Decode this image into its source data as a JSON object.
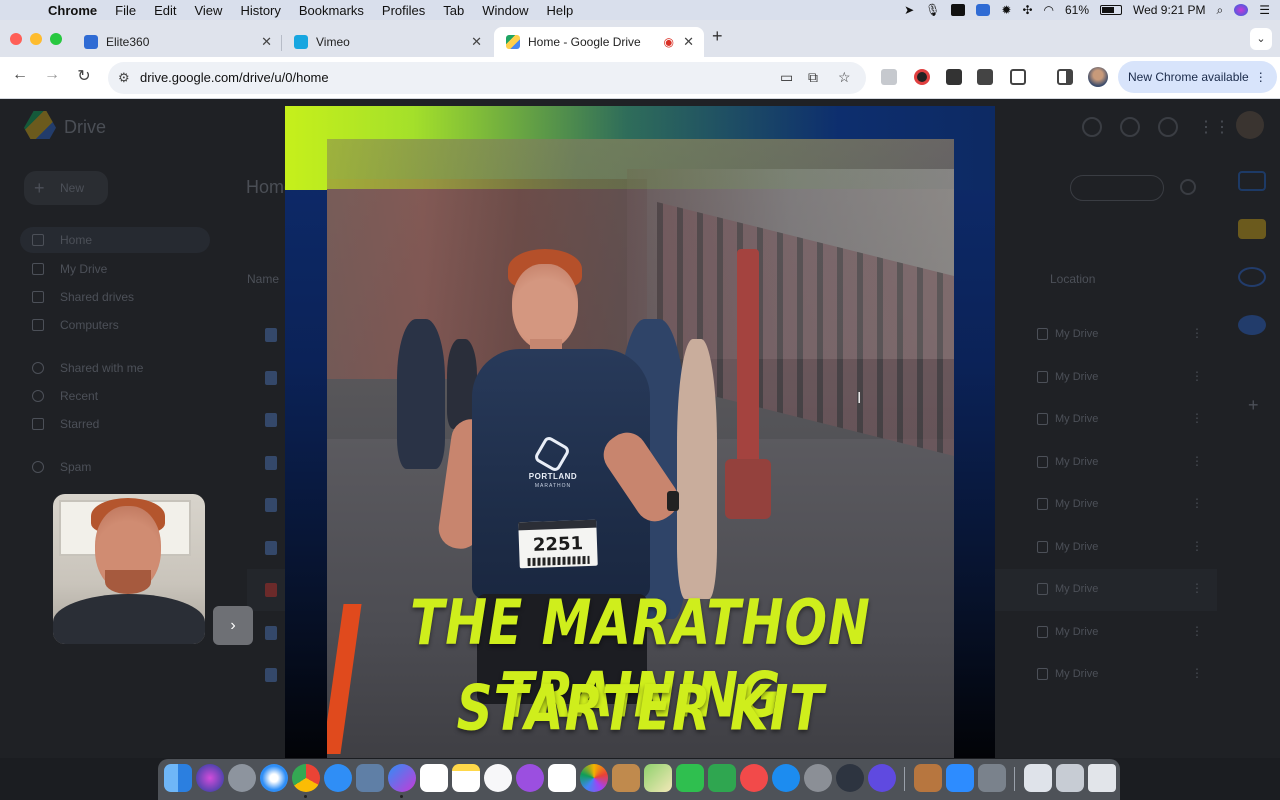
{
  "menubar": {
    "app": "Chrome",
    "menus": [
      "File",
      "Edit",
      "View",
      "History",
      "Bookmarks",
      "Profiles",
      "Tab",
      "Window",
      "Help"
    ],
    "battery": "61%",
    "clock": "Wed 9:21 PM"
  },
  "tabs": [
    {
      "title": "Elite360",
      "favicon": "elite360-logo",
      "color": "#2f6bd4",
      "active": false
    },
    {
      "title": "Vimeo",
      "favicon": "vimeo-logo",
      "color": "#17a6e0",
      "active": false
    },
    {
      "title": "Home - Google Drive",
      "favicon": "google-drive-logo",
      "color": "#1fa463",
      "active": true
    }
  ],
  "toolbar": {
    "url": "drive.google.com/drive/u/0/home",
    "update_button": "New Chrome available"
  },
  "drive": {
    "brand": "Drive",
    "new_button": "New",
    "nav": [
      "Home",
      "My Drive",
      "Shared drives",
      "Computers",
      "Shared with me",
      "Recent",
      "Starred",
      "Spam"
    ],
    "page_title": "Home",
    "columns": {
      "name": "Name",
      "location": "Location"
    },
    "rows": [
      {
        "location": "My Drive"
      },
      {
        "location": "My Drive"
      },
      {
        "location": "My Drive"
      },
      {
        "location": "My Drive"
      },
      {
        "location": "My Drive"
      },
      {
        "location": "My Drive"
      },
      {
        "location": "My Drive"
      },
      {
        "location": "My Drive"
      },
      {
        "location": "My Drive"
      }
    ]
  },
  "preview": {
    "headline_line1": "THE MARATHON TRAINING",
    "headline_line2": "STARTER KIT",
    "shirt_text": "PORTLAND",
    "shirt_subtext": "MARATHON",
    "bib_number": "2251",
    "accent_color": "#cfee1c"
  },
  "dock": {
    "icons": [
      "finder",
      "siri",
      "launchpad",
      "safari",
      "chrome",
      "messages",
      "preview",
      "messenger",
      "calendar",
      "notes",
      "music",
      "podcasts",
      "reminders",
      "photos",
      "books",
      "maps",
      "facetime",
      "numbers",
      "news",
      "app-store",
      "system-settings",
      "quicktime",
      "imovie",
      "archive",
      "zoom",
      "screenshot",
      "window-previews",
      "trash"
    ]
  }
}
